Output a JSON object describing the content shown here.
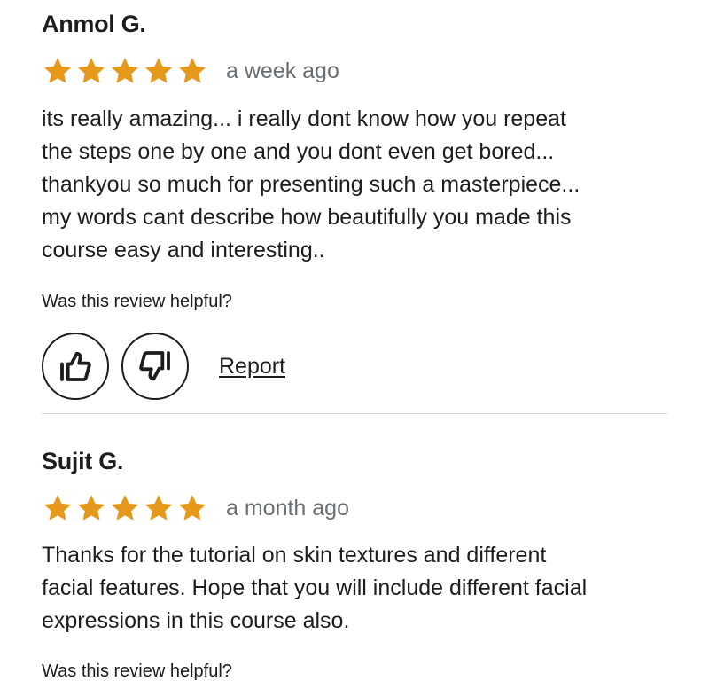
{
  "reviews": [
    {
      "name": "Anmol G.",
      "rating": 5,
      "date": "a week ago",
      "text": "its really amazing... i really dont know how you repeat\nthe steps one by one and you dont even get bored...\nthankyou so much for presenting such a masterpiece...\nmy words cant describe how beautifully you made this\ncourse easy and interesting..",
      "helpful_question": "Was this review helpful?",
      "report_label": "Report"
    },
    {
      "name": "Sujit G.",
      "rating": 5,
      "date": "a month ago",
      "text": "Thanks for the tutorial on skin textures and different\nfacial features. Hope that you will include different facial\nexpressions in this course also.",
      "helpful_question": "Was this review helpful?"
    }
  ],
  "icons": {
    "star": "star-icon",
    "thumbs_up": "thumbs-up-icon",
    "thumbs_down": "thumbs-down-icon"
  },
  "colors": {
    "star": "#e59819",
    "text": "#1c1d1f",
    "muted": "#6a6f73",
    "divider": "#d1d7dc"
  }
}
